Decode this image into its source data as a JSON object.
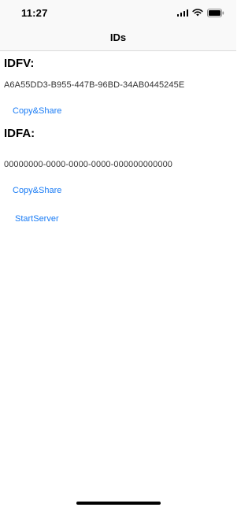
{
  "status_bar": {
    "time": "11:27",
    "icons": [
      "signal-icon",
      "wifi-icon",
      "battery-icon"
    ]
  },
  "nav": {
    "title": "IDs"
  },
  "idfv": {
    "heading": "IDFV:",
    "value": "A6A55DD3-B955-447B-96BD-34AB0445245E",
    "button_label": "Copy&Share"
  },
  "idfa": {
    "heading": "IDFA:",
    "value": "00000000-0000-0000-0000-000000000000",
    "button_label": "Copy&Share"
  },
  "start_server": {
    "label": "StartServer"
  },
  "colors": {
    "accent": "#1a7cf5",
    "bar_background": "#f9f9f9"
  }
}
